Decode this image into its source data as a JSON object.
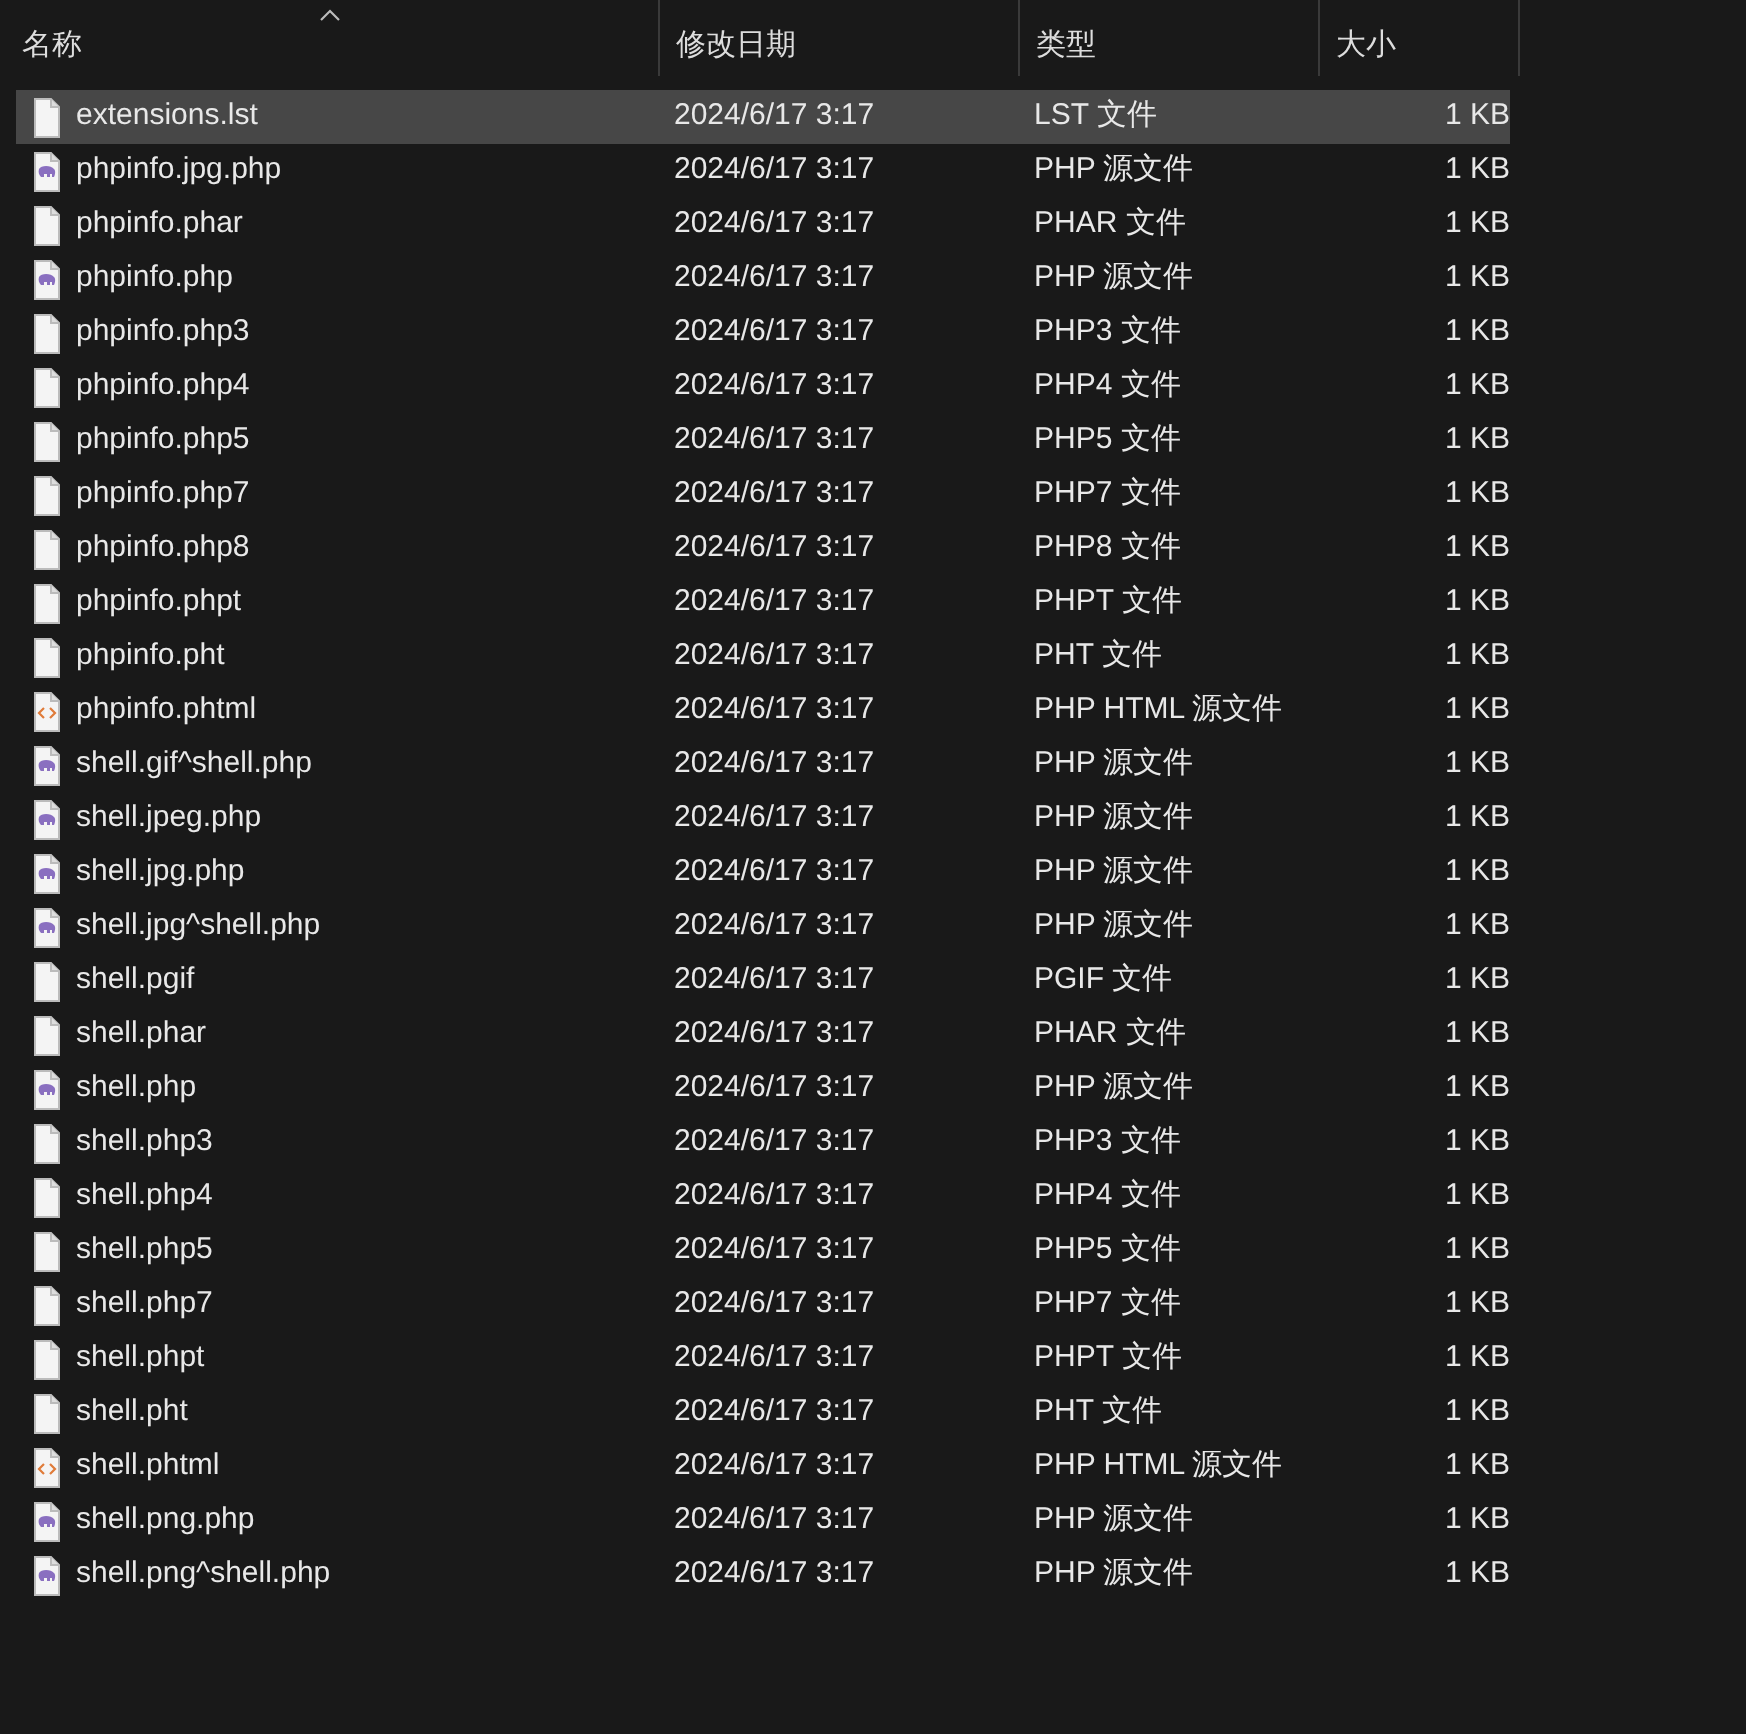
{
  "columns": [
    {
      "label": "名称",
      "sorted": true
    },
    {
      "label": "修改日期",
      "sorted": false
    },
    {
      "label": "类型",
      "sorted": false
    },
    {
      "label": "大小",
      "sorted": false
    }
  ],
  "files": [
    {
      "name": "extensions.lst",
      "kind": "plain",
      "date": "2024/6/17 3:17",
      "type": "LST 文件",
      "size": "1 KB",
      "selected": true
    },
    {
      "name": "phpinfo.jpg.php",
      "kind": "php",
      "date": "2024/6/17 3:17",
      "type": "PHP 源文件",
      "size": "1 KB",
      "selected": false
    },
    {
      "name": "phpinfo.phar",
      "kind": "plain",
      "date": "2024/6/17 3:17",
      "type": "PHAR 文件",
      "size": "1 KB",
      "selected": false
    },
    {
      "name": "phpinfo.php",
      "kind": "php",
      "date": "2024/6/17 3:17",
      "type": "PHP 源文件",
      "size": "1 KB",
      "selected": false
    },
    {
      "name": "phpinfo.php3",
      "kind": "plain",
      "date": "2024/6/17 3:17",
      "type": "PHP3 文件",
      "size": "1 KB",
      "selected": false
    },
    {
      "name": "phpinfo.php4",
      "kind": "plain",
      "date": "2024/6/17 3:17",
      "type": "PHP4 文件",
      "size": "1 KB",
      "selected": false
    },
    {
      "name": "phpinfo.php5",
      "kind": "plain",
      "date": "2024/6/17 3:17",
      "type": "PHP5 文件",
      "size": "1 KB",
      "selected": false
    },
    {
      "name": "phpinfo.php7",
      "kind": "plain",
      "date": "2024/6/17 3:17",
      "type": "PHP7 文件",
      "size": "1 KB",
      "selected": false
    },
    {
      "name": "phpinfo.php8",
      "kind": "plain",
      "date": "2024/6/17 3:17",
      "type": "PHP8 文件",
      "size": "1 KB",
      "selected": false
    },
    {
      "name": "phpinfo.phpt",
      "kind": "plain",
      "date": "2024/6/17 3:17",
      "type": "PHPT 文件",
      "size": "1 KB",
      "selected": false
    },
    {
      "name": "phpinfo.pht",
      "kind": "plain",
      "date": "2024/6/17 3:17",
      "type": "PHT 文件",
      "size": "1 KB",
      "selected": false
    },
    {
      "name": "phpinfo.phtml",
      "kind": "html",
      "date": "2024/6/17 3:17",
      "type": "PHP HTML 源文件",
      "size": "1 KB",
      "selected": false
    },
    {
      "name": "shell.gif^shell.php",
      "kind": "php",
      "date": "2024/6/17 3:17",
      "type": "PHP 源文件",
      "size": "1 KB",
      "selected": false
    },
    {
      "name": "shell.jpeg.php",
      "kind": "php",
      "date": "2024/6/17 3:17",
      "type": "PHP 源文件",
      "size": "1 KB",
      "selected": false
    },
    {
      "name": "shell.jpg.php",
      "kind": "php",
      "date": "2024/6/17 3:17",
      "type": "PHP 源文件",
      "size": "1 KB",
      "selected": false
    },
    {
      "name": "shell.jpg^shell.php",
      "kind": "php",
      "date": "2024/6/17 3:17",
      "type": "PHP 源文件",
      "size": "1 KB",
      "selected": false
    },
    {
      "name": "shell.pgif",
      "kind": "plain",
      "date": "2024/6/17 3:17",
      "type": "PGIF 文件",
      "size": "1 KB",
      "selected": false
    },
    {
      "name": "shell.phar",
      "kind": "plain",
      "date": "2024/6/17 3:17",
      "type": "PHAR 文件",
      "size": "1 KB",
      "selected": false
    },
    {
      "name": "shell.php",
      "kind": "php",
      "date": "2024/6/17 3:17",
      "type": "PHP 源文件",
      "size": "1 KB",
      "selected": false
    },
    {
      "name": "shell.php3",
      "kind": "plain",
      "date": "2024/6/17 3:17",
      "type": "PHP3 文件",
      "size": "1 KB",
      "selected": false
    },
    {
      "name": "shell.php4",
      "kind": "plain",
      "date": "2024/6/17 3:17",
      "type": "PHP4 文件",
      "size": "1 KB",
      "selected": false
    },
    {
      "name": "shell.php5",
      "kind": "plain",
      "date": "2024/6/17 3:17",
      "type": "PHP5 文件",
      "size": "1 KB",
      "selected": false
    },
    {
      "name": "shell.php7",
      "kind": "plain",
      "date": "2024/6/17 3:17",
      "type": "PHP7 文件",
      "size": "1 KB",
      "selected": false
    },
    {
      "name": "shell.phpt",
      "kind": "plain",
      "date": "2024/6/17 3:17",
      "type": "PHPT 文件",
      "size": "1 KB",
      "selected": false
    },
    {
      "name": "shell.pht",
      "kind": "plain",
      "date": "2024/6/17 3:17",
      "type": "PHT 文件",
      "size": "1 KB",
      "selected": false
    },
    {
      "name": "shell.phtml",
      "kind": "html",
      "date": "2024/6/17 3:17",
      "type": "PHP HTML 源文件",
      "size": "1 KB",
      "selected": false
    },
    {
      "name": "shell.png.php",
      "kind": "php",
      "date": "2024/6/17 3:17",
      "type": "PHP 源文件",
      "size": "1 KB",
      "selected": false
    },
    {
      "name": "shell.png^shell.php",
      "kind": "php",
      "date": "2024/6/17 3:17",
      "type": "PHP 源文件",
      "size": "1 KB",
      "selected": false
    }
  ]
}
